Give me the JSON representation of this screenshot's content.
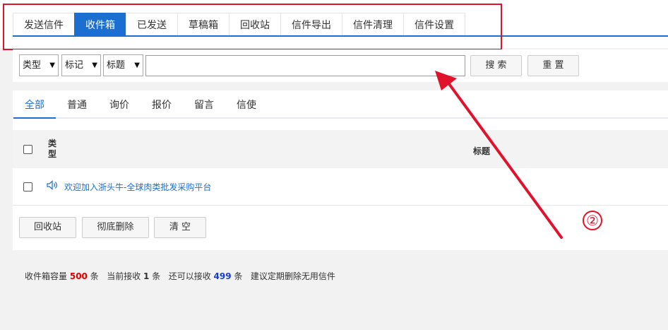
{
  "tabs": [
    "发送信件",
    "收件箱",
    "已发送",
    "草稿箱",
    "回收站",
    "信件导出",
    "信件清理",
    "信件设置"
  ],
  "filters": {
    "type": "类型",
    "mark": "标记",
    "title": "标题"
  },
  "search": {
    "value": "",
    "search_label": "搜 索",
    "reset_label": "重 置"
  },
  "subtabs": [
    "全部",
    "普通",
    "询价",
    "报价",
    "留言",
    "信使"
  ],
  "table": {
    "col_type": "类型",
    "col_title": "标题"
  },
  "message": {
    "title": "欢迎加入浙头牛-全球肉类批发采购平台"
  },
  "actions": {
    "recycle": "回收站",
    "delete": "彻底删除",
    "clear": "清 空"
  },
  "footer": {
    "capacity_label": "收件箱容量",
    "capacity": "500",
    "unit1": "条",
    "current_label": "当前接收",
    "current": "1",
    "unit2": "条",
    "remain_label": "还可以接收",
    "remain": "499",
    "unit3": "条",
    "tip": "建议定期删除无用信件"
  },
  "annotation": {
    "number": "②"
  },
  "colors": {
    "accent": "#1a6fd1",
    "annotation": "#e0122c"
  }
}
